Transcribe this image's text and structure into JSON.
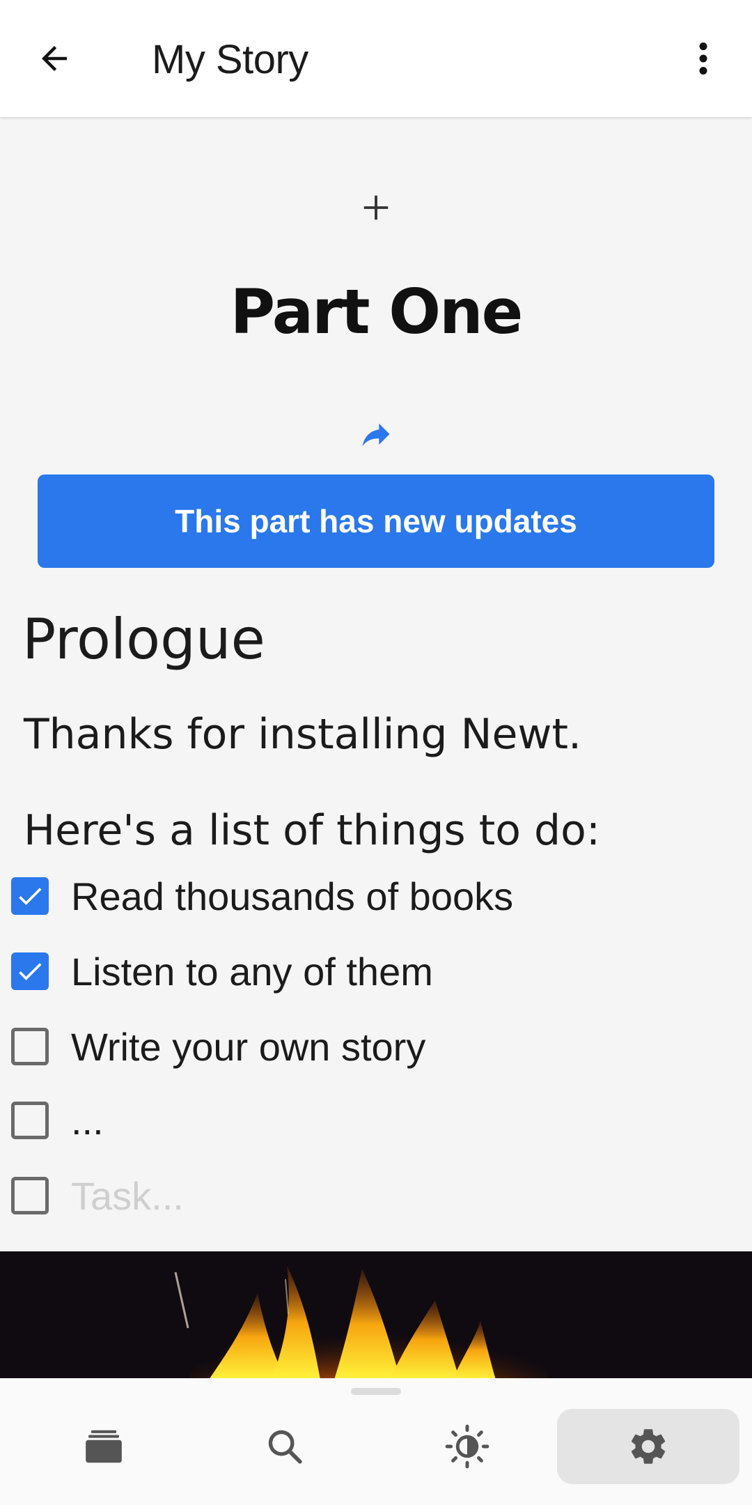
{
  "appbar": {
    "title": "My Story",
    "back_icon": "arrow-back-icon",
    "more_icon": "more-vertical-icon"
  },
  "content": {
    "add_part_icon": "plus-icon",
    "part_title": "Part One",
    "share_icon": "share-arrow-icon",
    "updates_button": "This part has new updates",
    "chapter_title": "Prologue",
    "paragraphs": [
      "Thanks for installing Newt.",
      "Here's a list of things to do:"
    ],
    "tasks": [
      {
        "label": "Read thousands of books",
        "checked": true
      },
      {
        "label": "Listen to any of them",
        "checked": true
      },
      {
        "label": "Write your own story",
        "checked": false
      },
      {
        "label": "...",
        "checked": false
      }
    ],
    "task_placeholder": "Task..."
  },
  "bottom_nav": {
    "items": [
      {
        "icon": "library-stack-icon",
        "selected": false
      },
      {
        "icon": "search-icon",
        "selected": false
      },
      {
        "icon": "brightness-icon",
        "selected": false
      },
      {
        "icon": "settings-gear-icon",
        "selected": true
      }
    ]
  },
  "colors": {
    "accent": "#2a78eb",
    "background": "#f5f5f5",
    "appbar": "#ffffff",
    "text": "#1b1b1b",
    "checkbox_border": "#6a6a6a",
    "placeholder": "#cfcfcf",
    "nav_selected": "#e4e4e4",
    "icon_gray": "#555555"
  }
}
